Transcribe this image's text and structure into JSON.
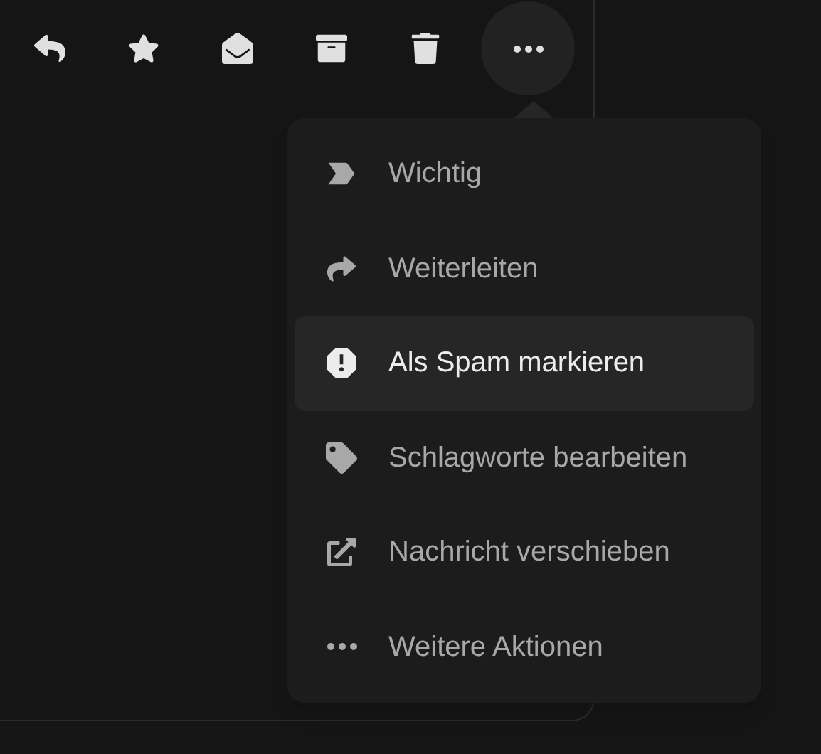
{
  "more_menu": {
    "expanded": true,
    "items": [
      {
        "label": "Wichtig",
        "selected": false
      },
      {
        "label": "Weiterleiten",
        "selected": false
      },
      {
        "label": "Als Spam markieren",
        "selected": true
      },
      {
        "label": "Schlagworte bearbeiten",
        "selected": false
      },
      {
        "label": "Nachricht verschieben",
        "selected": false
      },
      {
        "label": "Weitere Aktionen",
        "selected": false
      }
    ]
  }
}
